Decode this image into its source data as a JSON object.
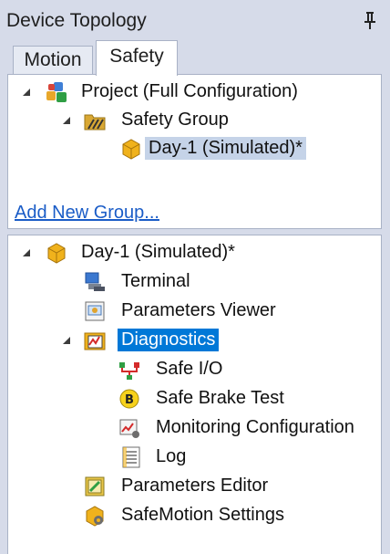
{
  "window": {
    "title": "Device Topology"
  },
  "tabs": [
    {
      "label": "Motion",
      "active": false
    },
    {
      "label": "Safety",
      "active": true
    }
  ],
  "top_tree": {
    "project_label": "Project (Full Configuration)",
    "group_label": "Safety Group",
    "device_label": "Day-1 (Simulated)*"
  },
  "add_group_link": "Add New Group...",
  "bottom_tree": {
    "root_label": "Day-1 (Simulated)*",
    "items": [
      {
        "label": "Terminal",
        "icon": "terminal-icon"
      },
      {
        "label": "Parameters Viewer",
        "icon": "parameters-viewer-icon"
      },
      {
        "label": "Diagnostics",
        "icon": "diagnostics-icon"
      },
      {
        "label": "Safe I/O",
        "icon": "safe-io-icon"
      },
      {
        "label": "Safe Brake Test",
        "icon": "safe-brake-test-icon"
      },
      {
        "label": "Monitoring Configuration",
        "icon": "monitoring-configuration-icon"
      },
      {
        "label": "Log",
        "icon": "log-icon"
      },
      {
        "label": "Parameters Editor",
        "icon": "parameters-editor-icon"
      },
      {
        "label": "SafeMotion Settings",
        "icon": "safemotion-settings-icon"
      }
    ]
  },
  "colors": {
    "chrome": "#d6dbe9",
    "selection": "#c5d3e8",
    "active_selection": "#0078d7",
    "link": "#1a5cc7"
  }
}
